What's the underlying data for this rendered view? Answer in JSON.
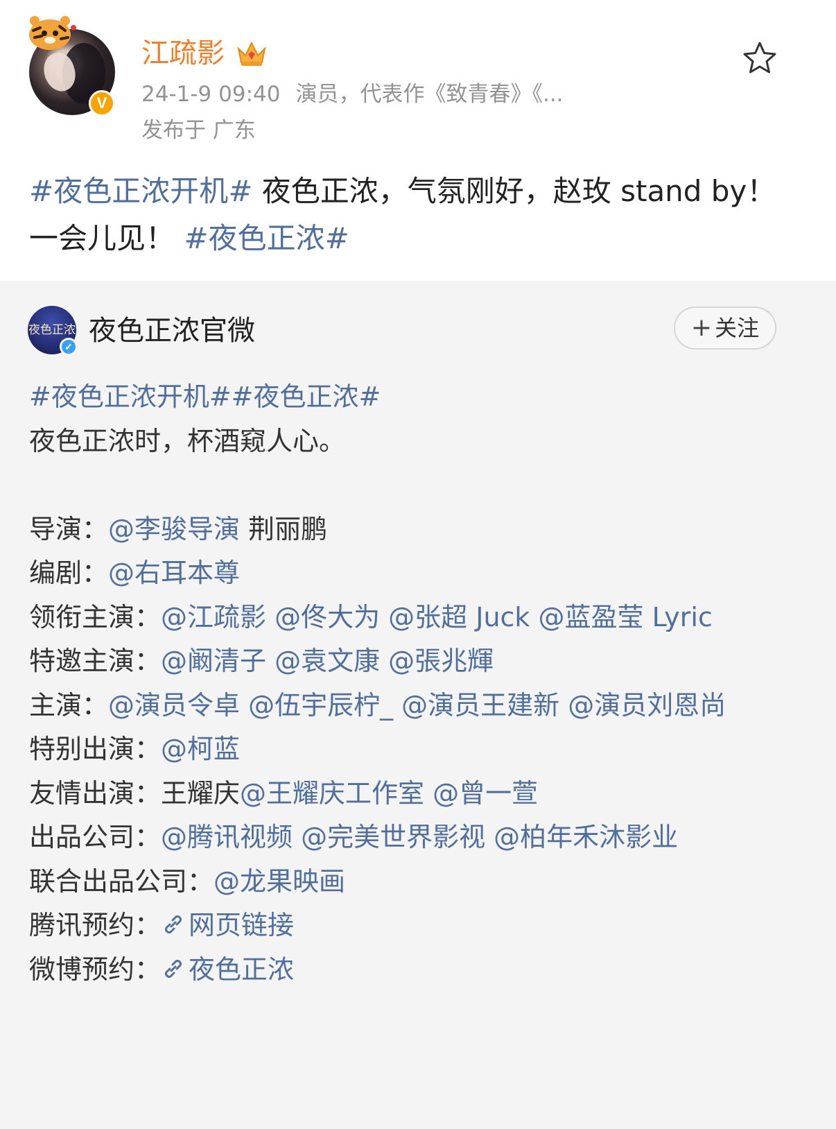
{
  "post": {
    "username": "江疏影",
    "timestamp": "24-1-9 09:40",
    "bio": "演员，代表作《致青春》《...",
    "location": "发布于 广东",
    "text_tag1": "#夜色正浓开机#",
    "text_main": " 夜色正浓，气氛刚好，赵玫 stand by！一会儿见！",
    "text_tag2": "#夜色正浓#",
    "verified_badge": "V",
    "icons": {
      "favorite": "star-outline-icon",
      "vip": "crown-icon",
      "verify": "verified-badge-icon"
    },
    "colors": {
      "username": "#f07f2a",
      "tag": "#526f9c",
      "meta": "#939393"
    }
  },
  "repost": {
    "account_name": "夜色正浓官微",
    "avatar_text": "夜色正浓",
    "follow_label": "关注",
    "follow_plus": "+",
    "tags_line": "#夜色正浓开机##夜色正浓#",
    "slogan": "夜色正浓时，杯酒窥人心。",
    "credits": [
      {
        "label": "导演：",
        "mentions": "@李骏导演",
        "plain": " 荆丽鹏"
      },
      {
        "label": "编剧：",
        "mentions": "@右耳本尊",
        "plain": ""
      },
      {
        "label": "领衔主演：",
        "mentions": "@江疏影 @佟大为 @张超 Juck @蓝盈莹 Lyric",
        "plain": ""
      },
      {
        "label": "特邀主演：",
        "mentions": "@阚清子 @袁文康 @張兆輝",
        "plain": ""
      },
      {
        "label": "主演：",
        "mentions": "@演员令卓 @伍宇辰柠_ @演员王建新 @演员刘恩尚",
        "plain": ""
      },
      {
        "label": "特别出演：",
        "mentions": "@柯蓝",
        "plain": ""
      },
      {
        "label": "友情出演：",
        "plain_before": "王耀庆",
        "mentions": "@王耀庆工作室 @曾一萱",
        "plain": ""
      },
      {
        "label": "出品公司：",
        "mentions": "@腾讯视频 @完美世界影视 @柏年禾沐影业",
        "plain": ""
      },
      {
        "label": "联合出品公司：",
        "mentions": "@龙果映画",
        "plain": ""
      }
    ],
    "links": [
      {
        "label": "腾讯预约：",
        "text": "网页链接",
        "icon": "link-icon"
      },
      {
        "label": "微博预约：",
        "text": "夜色正浓",
        "icon": "link-icon"
      }
    ]
  }
}
